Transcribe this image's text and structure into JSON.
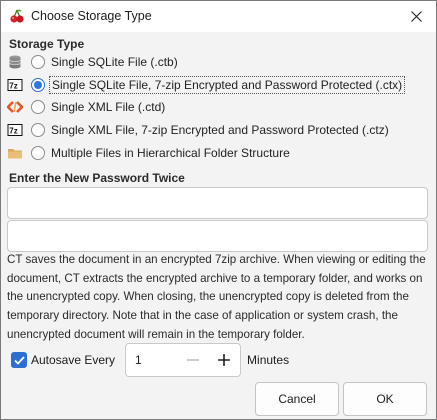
{
  "window": {
    "title": "Choose Storage Type"
  },
  "storage": {
    "heading": "Storage Type",
    "options": [
      {
        "label": "Single SQLite File (.ctb)",
        "selected": false,
        "icon": "database-icon"
      },
      {
        "label": "Single SQLite File, 7-zip Encrypted and Password Protected (.ctx)",
        "selected": true,
        "icon": "7zip-icon"
      },
      {
        "label": "Single XML File (.ctd)",
        "selected": false,
        "icon": "xml-icon"
      },
      {
        "label": "Single XML File, 7-zip Encrypted and Password Protected (.ctz)",
        "selected": false,
        "icon": "7zip-icon"
      },
      {
        "label": "Multiple Files in Hierarchical Folder Structure",
        "selected": false,
        "icon": "folder-icon"
      }
    ]
  },
  "password": {
    "heading": "Enter the New Password Twice",
    "field1_value": "",
    "field2_value": ""
  },
  "description": "CT saves the document in an encrypted 7zip archive. When viewing or editing the document, CT extracts the encrypted archive to a temporary folder, and works on the unencrypted copy. When closing, the unencrypted copy is deleted from the temporary directory. Note that in the case of application or system crash, the unencrypted document will remain in the temporary folder.",
  "autosave": {
    "checked": true,
    "label": "Autosave Every",
    "value": "1",
    "unit": "Minutes"
  },
  "buttons": {
    "cancel": "Cancel",
    "ok": "OK"
  },
  "colors": {
    "accent": "#2c6fd1"
  }
}
